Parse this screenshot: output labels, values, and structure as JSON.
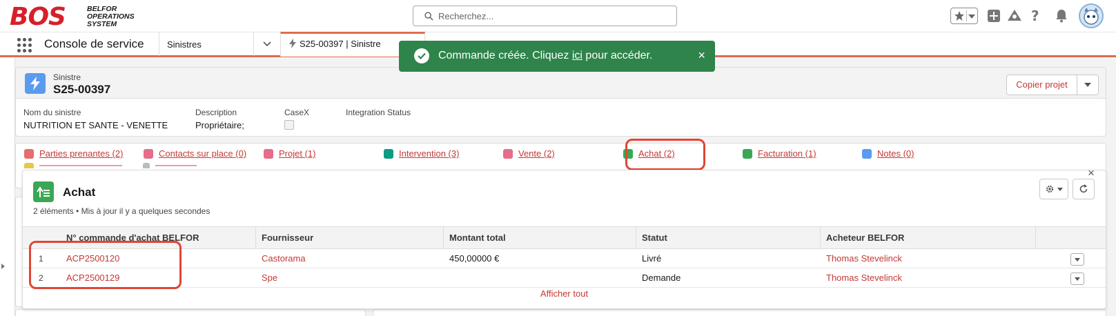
{
  "header": {
    "logo_mark": "BOS",
    "logo_line1": "BELFOR",
    "logo_line2": "OPERATIONS",
    "logo_line3": "SYSTEM",
    "search_placeholder": "Recherchez..."
  },
  "nav": {
    "app_name": "Console de service",
    "object_tab": "Sinistres",
    "record_tab": "S25-00397 | Sinistre"
  },
  "toast": {
    "prefix": "Commande créée. Cliquez ",
    "link": "ici",
    "suffix": " pour accéder.",
    "close": "×",
    "color": "#2e844a"
  },
  "record": {
    "type": "Sinistre",
    "title": "S25-00397",
    "copy_button": "Copier projet",
    "fields": [
      {
        "label": "Nom du sinistre",
        "value": "NUTRITION ET SANTE - VENETTE"
      },
      {
        "label": "Description",
        "value": "Propriétaire;"
      },
      {
        "label": "CaseX",
        "value": ""
      },
      {
        "label": "Integration Status",
        "value": ""
      }
    ]
  },
  "related_links": [
    {
      "label": "Parties prenantes (2)",
      "color": "#e56e6e"
    },
    {
      "label": "Contacts sur place (0)",
      "color": "#e56e8a"
    },
    {
      "label": "Projet (1)",
      "color": "#e56e8a"
    },
    {
      "label": "Intervention (3)",
      "color": "#0f9a86"
    },
    {
      "label": "Vente (2)",
      "color": "#e56e8a"
    },
    {
      "label": "Achat (2)",
      "color": "#3ba755"
    },
    {
      "label": "Facturation (1)",
      "color": "#3ba755"
    },
    {
      "label": "Notes (0)",
      "color": "#5a9bf0"
    }
  ],
  "panel": {
    "title": "Achat",
    "subtitle": "2 éléments • Mis à jour il y a quelques secondes",
    "close": "×",
    "columns": [
      "N° commande d'achat BELFOR",
      "Fournisseur",
      "Montant total",
      "Statut",
      "Acheteur BELFOR"
    ],
    "rows": [
      {
        "num": "1",
        "order": "ACP2500120",
        "supplier": "Castorama",
        "amount": "450,00000 €",
        "status": "Livré",
        "buyer": "Thomas Stevelinck"
      },
      {
        "num": "2",
        "order": "ACP2500129",
        "supplier": "Spe",
        "amount": "",
        "status": "Demande",
        "buyer": "Thomas Stevelinck"
      }
    ],
    "show_all": "Afficher tout"
  },
  "colors": {
    "brand_red": "#d6202a",
    "link_red": "#c23934",
    "highlight": "#e04535",
    "nav_accent": "#e06b4f"
  }
}
